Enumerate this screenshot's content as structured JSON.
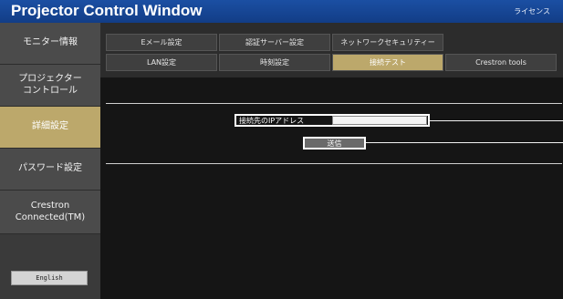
{
  "window": {
    "title": "Projector Control Window",
    "license_link": "ライセンス"
  },
  "sidebar": {
    "items": [
      {
        "label": "モニター情報",
        "active": false
      },
      {
        "label": "プロジェクター\nコントロール",
        "active": false
      },
      {
        "label": "詳細設定",
        "active": true
      },
      {
        "label": "パスワード設定",
        "active": false
      },
      {
        "label": "Crestron\nConnected(TM)",
        "active": false
      }
    ],
    "english_button": "English"
  },
  "tabs": {
    "row1": [
      "Eメール設定",
      "認証サーバー設定",
      "ネットワークセキュリティー"
    ],
    "row2": [
      "LAN設定",
      "時刻設定",
      "接続テスト",
      "Crestron tools"
    ],
    "active_tab": "接続テスト"
  },
  "connection_test": {
    "ip_label": "接続先のIPアドレス",
    "ip_value": "",
    "send_button": "送信"
  },
  "colors": {
    "titlebar": "#1b4fa3",
    "active_accent": "#bca86b",
    "sidebar_bg": "#4b4b4b",
    "content_bg": "#151515"
  }
}
